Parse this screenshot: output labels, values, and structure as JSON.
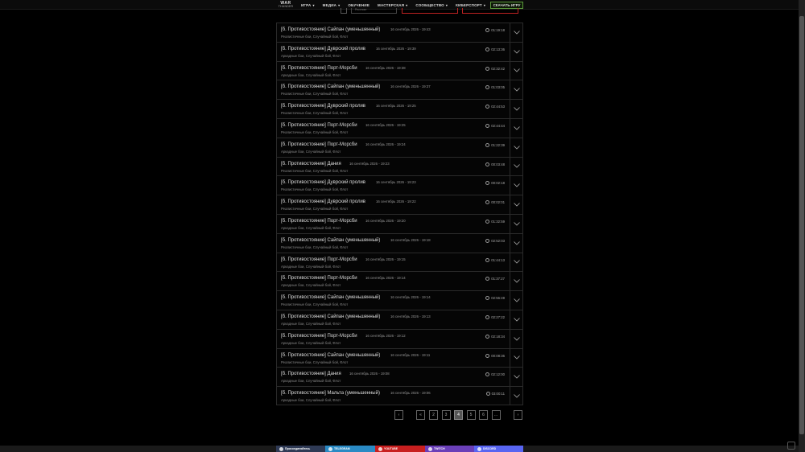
{
  "brand": {
    "line1": "WAR",
    "line2": "THUNDER"
  },
  "nav": [
    {
      "label": "Игра",
      "dropdown": true
    },
    {
      "label": "Медиа",
      "dropdown": true
    },
    {
      "label": "Обучение",
      "dropdown": false
    },
    {
      "label": "Мастерская",
      "dropdown": true
    },
    {
      "label": "Сообщество",
      "dropdown": true,
      "active": true
    },
    {
      "label": "Киберспорт",
      "dropdown": true
    }
  ],
  "download_label": "СКАЧАТЬ ИГРУ",
  "filter_placeholder": "Рестлинг",
  "battles": [
    {
      "title": "[б. Противостояние] Сайпан (уменьшенный)",
      "date": "16 сентябрь 2026 - 19:43",
      "mode": "Реалистичные бои, Случайный бой, Флот",
      "duration": "01:19:18"
    },
    {
      "title": "[б. Противостояние] Дуврский пролив",
      "date": "16 сентябрь 2026 - 19:39",
      "mode": "Аркадные бои, Случайный бой, Флот",
      "duration": "02:13:36"
    },
    {
      "title": "[б. Противостояние] Порт-Морсби",
      "date": "16 сентябрь 2026 - 19:38",
      "mode": "Аркадные бои, Случайный бой, Флот",
      "duration": "02:32:42"
    },
    {
      "title": "[б. Противостояние] Сайпан (уменьшенный)",
      "date": "16 сентябрь 2026 - 19:37",
      "mode": "Реалистичные бои, Случайный бой, Флот",
      "duration": "01:03:05"
    },
    {
      "title": "[б. Противостояние] Дуврский пролив",
      "date": "16 сентябрь 2026 - 19:25",
      "mode": "Реалистичные бои, Случайный бой, Флот",
      "duration": "02:44:53"
    },
    {
      "title": "[б. Противостояние] Порт-Морсби",
      "date": "16 сентябрь 2026 - 19:25",
      "mode": "Реалистичные бои, Случайный бой, Флот",
      "duration": "02:44:44"
    },
    {
      "title": "[б. Противостояние] Порт-Морсби",
      "date": "16 сентябрь 2026 - 19:24",
      "mode": "Аркадные бои, Случайный бой, Флот",
      "duration": "01:22:39"
    },
    {
      "title": "[б. Противостояние] Дания",
      "date": "16 сентябрь 2026 - 19:23",
      "mode": "Реалистичные бои, Случайный бой, Флот",
      "duration": "00:03:48"
    },
    {
      "title": "[б. Противостояние] Дуврский пролив",
      "date": "16 сентябрь 2026 - 19:23",
      "mode": "Реалистичные бои, Случайный бой, Флот",
      "duration": "00:02:18"
    },
    {
      "title": "[б. Противостояние] Дуврский пролив",
      "date": "16 сентябрь 2026 - 19:22",
      "mode": "Реалистичные бои, Случайный бой, Флот",
      "duration": "00:02:01"
    },
    {
      "title": "[б. Противостояние] Порт-Морсби",
      "date": "16 сентябрь 2026 - 19:20",
      "mode": "Аркадные бои, Случайный бой, Флот",
      "duration": "01:32:59"
    },
    {
      "title": "[б. Противостояние] Сайпан (уменьшенный)",
      "date": "16 сентябрь 2026 - 19:18",
      "mode": "Реалистичные бои, Случайный бой, Флот",
      "duration": "02:52:03"
    },
    {
      "title": "[б. Противостояние] Порт-Морсби",
      "date": "16 сентябрь 2026 - 19:15",
      "mode": "Аркадные бои, Случайный бой, Флот",
      "duration": "01:44:13"
    },
    {
      "title": "[б. Противостояние] Порт-Морсби",
      "date": "16 сентябрь 2026 - 19:14",
      "mode": "Аркадные бои, Случайный бой, Флот",
      "duration": "01:37:27"
    },
    {
      "title": "[б. Противостояние] Сайпан (уменьшенный)",
      "date": "16 сентябрь 2026 - 19:14",
      "mode": "Реалистичные бои, Случайный бой, Флот",
      "duration": "02:56:49"
    },
    {
      "title": "[б. Противостояние] Сайпан (уменьшенный)",
      "date": "16 сентябрь 2026 - 19:13",
      "mode": "Аркадные бои, Случайный бой, Флот",
      "duration": "02:27:22"
    },
    {
      "title": "[б. Противостояние] Порт-Морсби",
      "date": "16 сентябрь 2026 - 19:12",
      "mode": "Аркадные бои, Случайный бой, Флот",
      "duration": "02:18:34"
    },
    {
      "title": "[б. Противостояние] Сайпан (уменьшенный)",
      "date": "16 сентябрь 2026 - 19:11",
      "mode": "Реалистичные бои, Случайный бой, Флот",
      "duration": "00:08:36"
    },
    {
      "title": "[б. Противостояние] Дания",
      "date": "16 сентябрь 2026 - 19:08",
      "mode": "Аркадные бои, Случайный бой, Флот",
      "duration": "02:12:00"
    },
    {
      "title": "[б. Противостояние] Мальта (уменьшенный)",
      "date": "16 сентябрь 2026 - 19:06",
      "mode": "Аркадные бои, Случайный бой, Флот",
      "duration": "03:00:11"
    }
  ],
  "pager": {
    "prev": "‹",
    "first": "«",
    "pages": [
      "2",
      "3",
      "4",
      "5",
      "6",
      "…"
    ],
    "active_page": "4",
    "next": "›"
  },
  "footer": [
    {
      "label": "Присоединяйтесь",
      "color": "#2f3a55",
      "icon": "join-icon"
    },
    {
      "label": "TELEGRAM",
      "color": "#2a8ac4",
      "icon": "telegram-icon"
    },
    {
      "label": "YOUTUBE",
      "color": "#c81f1f",
      "icon": "youtube-icon"
    },
    {
      "label": "TWITCH",
      "color": "#6a3fb8",
      "icon": "twitch-icon"
    },
    {
      "label": "DISCORD",
      "color": "#5865f2",
      "icon": "discord-icon"
    }
  ]
}
